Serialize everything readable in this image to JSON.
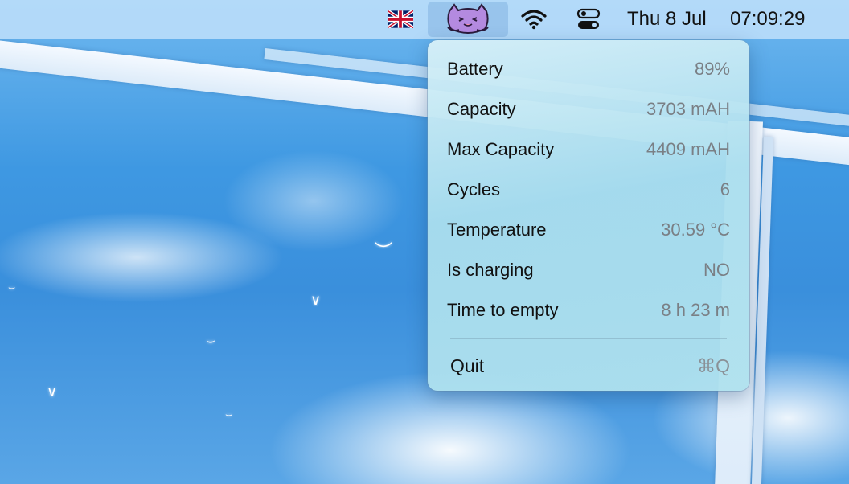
{
  "menubar": {
    "flag_icon": "uk-flag-icon",
    "app_icon": "purple-cat-battery-icon",
    "wifi_icon": "wifi-icon",
    "control_center_icon": "control-center-icon",
    "date": "Thu 8 Jul",
    "time": "07:09:29"
  },
  "menu": {
    "rows": [
      {
        "label": "Battery",
        "value": "89%"
      },
      {
        "label": "Capacity",
        "value": "3703 mAH"
      },
      {
        "label": "Max Capacity",
        "value": "4409 mAH"
      },
      {
        "label": "Cycles",
        "value": "6"
      },
      {
        "label": "Temperature",
        "value": "30.59 °C"
      },
      {
        "label": "Is charging",
        "value": "NO"
      },
      {
        "label": "Time to empty",
        "value": "8 h 23 m"
      }
    ],
    "quit_label": "Quit",
    "quit_shortcut": "⌘Q"
  },
  "colors": {
    "menubar_bg": "#b9dcfa",
    "menu_bg": "#aadeee",
    "value_text": "#7a7f85",
    "app_icon_purple": "#b48ae0"
  }
}
